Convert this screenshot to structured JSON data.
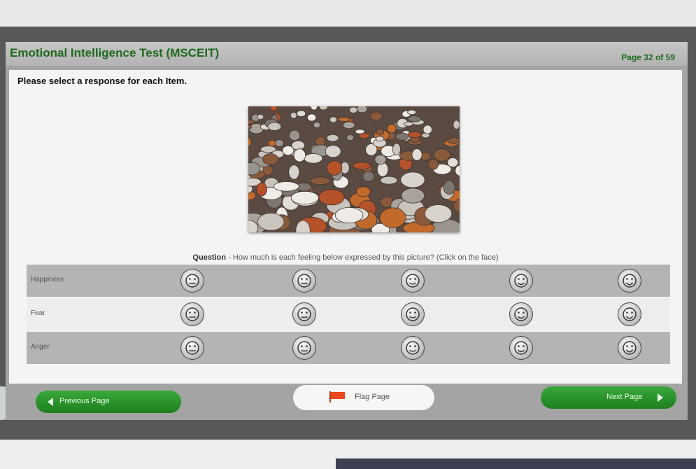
{
  "app": {
    "title": "Emotional Intelligence Test (MSCEIT)",
    "page_indicator": "Page 32 of 59"
  },
  "instructions": "Please select a response for each Item.",
  "question": {
    "label": "Question",
    "text": " - How much is each feeling below expressed by this picture? (Click on the face)"
  },
  "rows": [
    {
      "label": "Happiness"
    },
    {
      "label": "Fear"
    },
    {
      "label": "Anger"
    }
  ],
  "scale_levels": 5,
  "navigation": {
    "previous_label": "Previous Page",
    "flag_label": "Flag Page",
    "next_label": "Next Page"
  },
  "colors": {
    "brand_green": "#1d6a1d",
    "button_green": "#2a952a",
    "flag_orange": "#e8481a"
  },
  "icons": {
    "previous": "chevron-left-icon",
    "next": "chevron-right-icon",
    "flag": "flag-icon",
    "face": "face-icon"
  }
}
